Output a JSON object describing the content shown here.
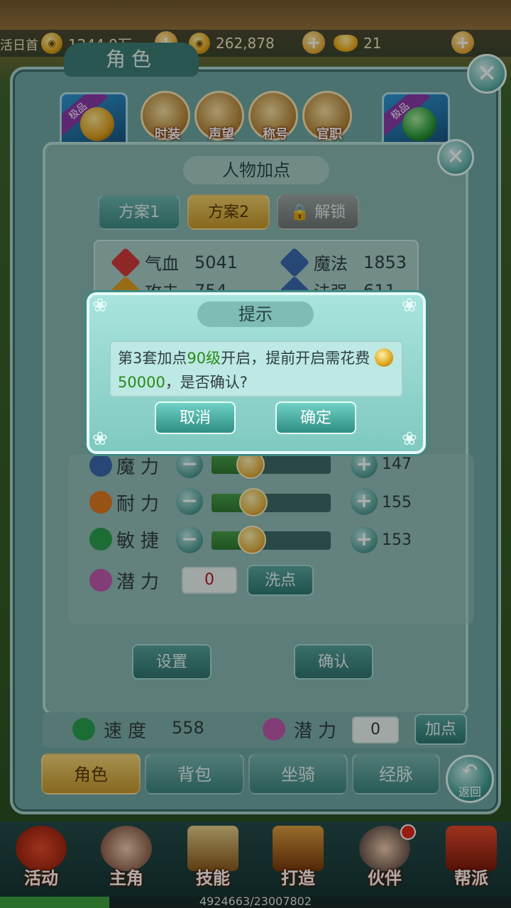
{
  "resources": {
    "left_edge": "活日首",
    "silver": "1244.9万",
    "silver_icon": "silver-coin-icon",
    "gold_coin": "262,878",
    "ingot": "21"
  },
  "panel": {
    "title": "角色",
    "icons": [
      "时装",
      "声望",
      "称号",
      "官职"
    ],
    "badge_left": "极品",
    "badge_right": "极品"
  },
  "inner": {
    "title": "人物加点",
    "schemes": [
      "方案1",
      "方案2",
      "解锁"
    ],
    "stats": [
      {
        "label": "气血",
        "value": "5041"
      },
      {
        "label": "魔法",
        "value": "1853"
      },
      {
        "label": "攻击",
        "value": "754"
      },
      {
        "label": "法强",
        "value": "611"
      }
    ],
    "rows": [
      {
        "label": "魔力",
        "value": "147",
        "level": 0.33
      },
      {
        "label": "耐力",
        "value": "155",
        "level": 0.35
      },
      {
        "label": "敏捷",
        "value": "153",
        "level": 0.34
      }
    ],
    "potential_label": "潜力",
    "potential_value": "0",
    "wash_label": "洗点",
    "settings_label": "设置",
    "confirm_label": "确认"
  },
  "footer_stats": {
    "speed_label": "速度",
    "speed_value": "558",
    "potential_label": "潜力",
    "potential_value": "0",
    "add_label": "加点"
  },
  "tabs": [
    "角色",
    "背包",
    "坐骑",
    "经脉"
  ],
  "back_label": "返回",
  "dialog": {
    "title": "提示",
    "text_1": "第3套加点",
    "text_hl_1": "90级",
    "text_2": "开启，提前开启需花费",
    "text_hl_2": "50000",
    "text_3": "，是否确认?",
    "cancel": "取消",
    "ok": "确定"
  },
  "nav": [
    "活动",
    "主角",
    "技能",
    "打造",
    "伙伴",
    "帮派"
  ],
  "exp": {
    "text": "4924663/23007802",
    "fraction": 0.214
  }
}
